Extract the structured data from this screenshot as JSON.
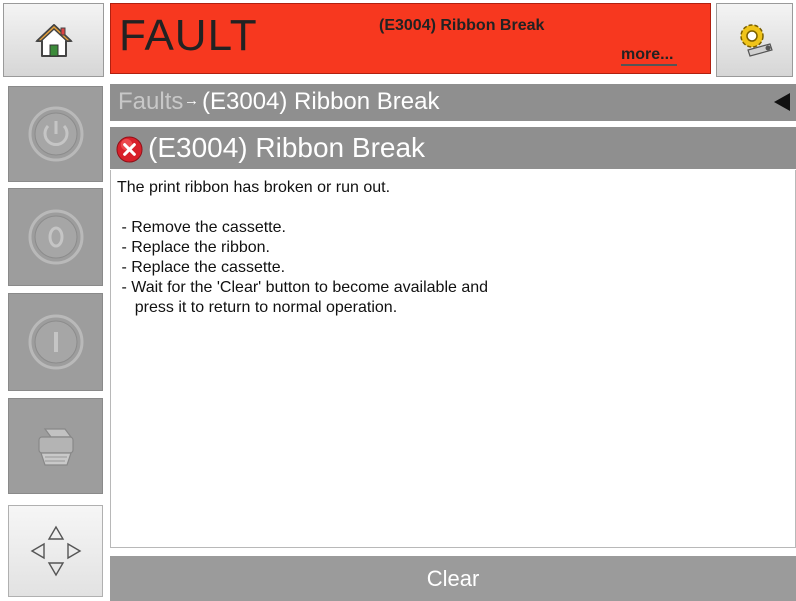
{
  "header": {
    "status_word": "FAULT",
    "fault_code_text": "(E3004) Ribbon Break",
    "more_link": "more..."
  },
  "icons": {
    "home": "home-icon",
    "settings": "settings-gear-icon",
    "power": "power-icon",
    "stop": "stop-icon",
    "start": "start-icon",
    "printer": "printer-icon",
    "navigate": "navigate-arrows-icon",
    "back": "back-triangle-icon",
    "error": "error-x-icon"
  },
  "breadcrumb": {
    "root": "Faults",
    "separator": "→",
    "current": "(E3004) Ribbon Break"
  },
  "detail": {
    "title": "(E3004) Ribbon Break",
    "lines": [
      "The print ribbon has broken or run out.",
      "",
      " - Remove the cassette.",
      " - Replace the ribbon.",
      " - Replace the cassette.",
      " - Wait for the 'Clear' button to become available and",
      "    press it to return to normal operation."
    ]
  },
  "footer": {
    "clear_label": "Clear"
  },
  "colors": {
    "fault_red": "#f7381f",
    "panel_gray": "#8f8f8f",
    "disabled_gray": "#9d9d9d"
  }
}
